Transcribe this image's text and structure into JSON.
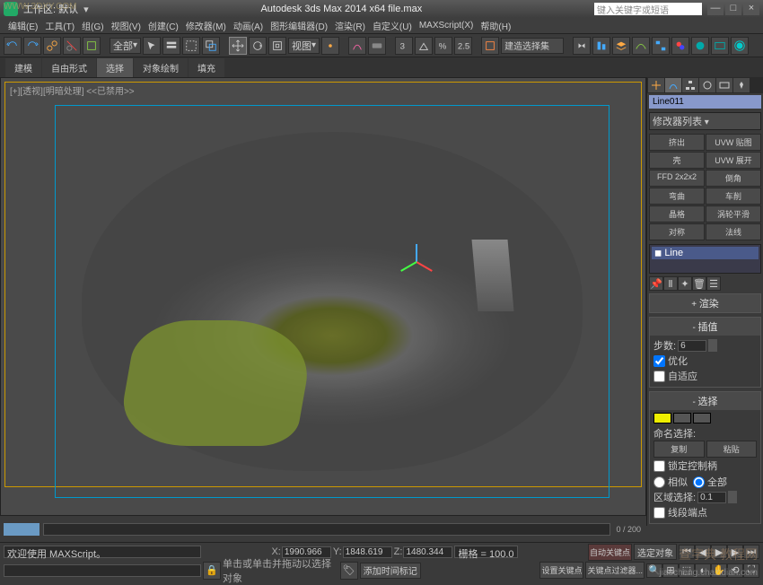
{
  "title_bar": {
    "workspace_label": "工作区: 默认",
    "app_title": "Autodesk 3ds Max  2014 x64     file.max",
    "search_placeholder": "键入关键字或短语",
    "min": "—",
    "max": "□",
    "close": "×"
  },
  "menus": [
    "编辑(E)",
    "工具(T)",
    "组(G)",
    "视图(V)",
    "创建(C)",
    "修改器(M)",
    "动画(A)",
    "图形编辑器(D)",
    "渲染(R)",
    "自定义(U)",
    "MAXScript(X)",
    "帮助(H)"
  ],
  "toolbar": {
    "selection_set": "全部",
    "view_dd": "视图",
    "snap_val": "2.5"
  },
  "ribbon_tabs": [
    "建模",
    "自由形式",
    "选择",
    "对象绘制",
    "填充"
  ],
  "ribbon_active": 2,
  "viewport": {
    "label": "[+][透视][明暗处理]  <<已禁用>>",
    "frame_range": "0 / 200",
    "gizmo_z": "z"
  },
  "side": {
    "object_name": "Line011",
    "mod_list_label": "修改器列表",
    "mod_buttons": [
      [
        "挤出",
        "UVW 贴图"
      ],
      [
        "壳",
        "UVW 展开"
      ],
      [
        "FFD 2x2x2",
        "倒角"
      ],
      [
        "弯曲",
        "车削"
      ],
      [
        "晶格",
        "涡轮平滑"
      ],
      [
        "对称",
        "法线"
      ]
    ],
    "stack_item": "Line",
    "render_h": "渲染",
    "interp_h": "插值",
    "steps_label": "步数:",
    "steps_val": "6",
    "optimize": "优化",
    "adaptive": "自适应",
    "select_h": "选择",
    "named_sel": "命名选择:",
    "copy_btn": "复制",
    "paste_btn": "粘贴",
    "lock_handles": "锁定控制柄",
    "rel": "相似",
    "abs": "全部",
    "area_sel": "区域选择:",
    "area_val": "0.1",
    "seg_end": "线段端点"
  },
  "status": {
    "welcome": "欢迎使用 MAXScript。",
    "prompt": "单击或单击并拖动以选择对象",
    "add_time_tag": "添加时间标记",
    "x": "1990.966",
    "y": "1848.619",
    "z": "1480.344",
    "grid_label": "栅格 = 100.0",
    "autokey": "自动关键点",
    "sel_obj": "选定对象",
    "setkey": "设置关键点",
    "keyfilter": "关键点过滤器..."
  },
  "watermarks": {
    "tl": "WWW.3DXY.COM",
    "br": "jiaocheng.chazidian.com",
    "br2": "查字典 教程网"
  }
}
